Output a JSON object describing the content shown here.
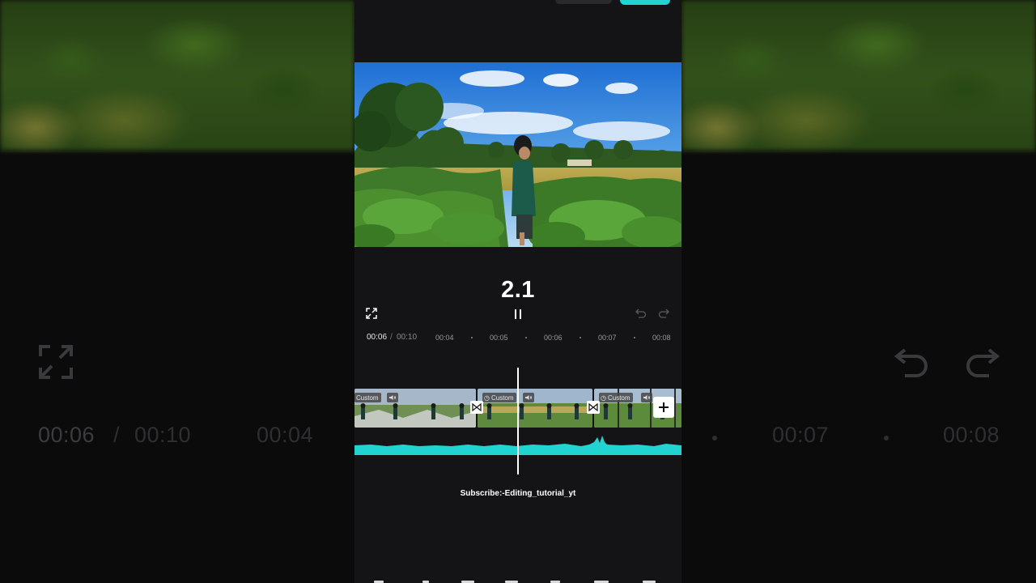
{
  "preview": {
    "counter": "2.1"
  },
  "playback": {
    "current_time": "00:06",
    "separator": "/",
    "total_time": "00:10"
  },
  "ruler": {
    "ticks": [
      "00:04",
      "00:05",
      "00:06",
      "00:07",
      "00:08"
    ]
  },
  "timeline": {
    "clips": [
      {
        "badge": "Custom"
      },
      {
        "badge": "Custom"
      },
      {
        "badge": "Custom"
      }
    ]
  },
  "background": {
    "ghost_current_time": "00:06",
    "ghost_separator": "/",
    "ghost_total_time": "00:10",
    "ghost_tick_left": "00:04",
    "ghost_tick_right_1": "00:07",
    "ghost_tick_right_2": "00:08"
  },
  "watermark": {
    "text": "Subscribe:-Editing_tutorial_yt"
  },
  "colors": {
    "accent": "#21d4d1",
    "panel": "#141416",
    "background": "#000000"
  },
  "icons": {
    "fullscreen": "fullscreen-icon",
    "pause": "pause-icon",
    "undo": "undo-icon",
    "redo": "redo-icon",
    "mute": "mute-icon",
    "transition": "transition-icon",
    "add": "plus-icon"
  }
}
